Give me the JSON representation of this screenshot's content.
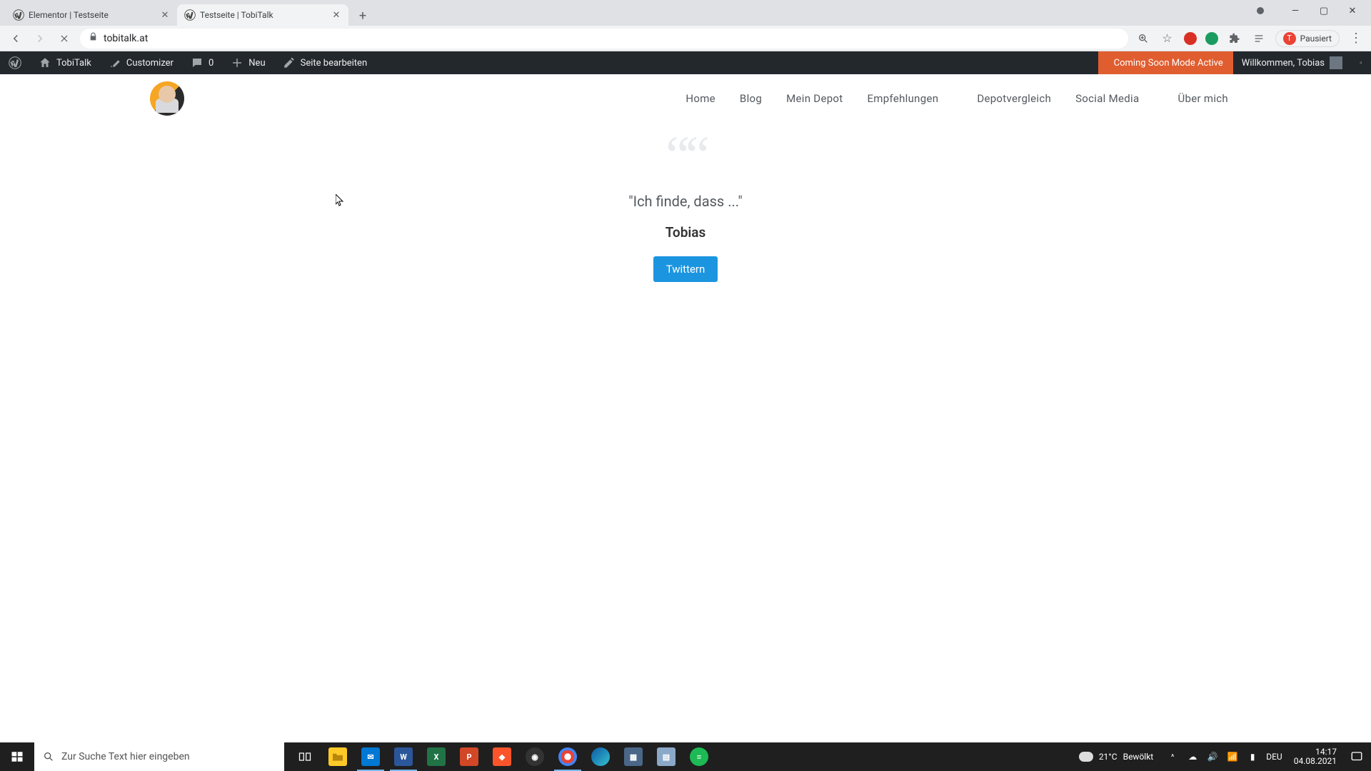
{
  "browser": {
    "tabs": [
      {
        "title": "Elementor | Testseite",
        "active": false
      },
      {
        "title": "Testseite | TobiTalk",
        "active": true
      }
    ],
    "url": "tobitalk.at",
    "paused_label": "Pausiert",
    "profile_initial": "T"
  },
  "wp_bar": {
    "site_name": "TobiTalk",
    "customizer": "Customizer",
    "comments_count": "0",
    "new_label": "Neu",
    "edit_label": "Seite bearbeiten",
    "coming_soon": "Coming Soon Mode Active",
    "welcome": "Willkommen, Tobias"
  },
  "nav": {
    "items": [
      "Home",
      "Blog",
      "Mein Depot",
      "Empfehlungen",
      "Depotvergleich",
      "Social Media",
      "Über mich"
    ]
  },
  "quote": {
    "text": "\"Ich finde, dass ...\"",
    "author": "Tobias",
    "button": "Twittern"
  },
  "taskbar": {
    "search_placeholder": "Zur Suche Text hier eingeben",
    "weather_temp": "21°C",
    "weather_desc": "Bewölkt",
    "lang": "DEU",
    "time": "14:17",
    "date": "04.08.2021"
  }
}
